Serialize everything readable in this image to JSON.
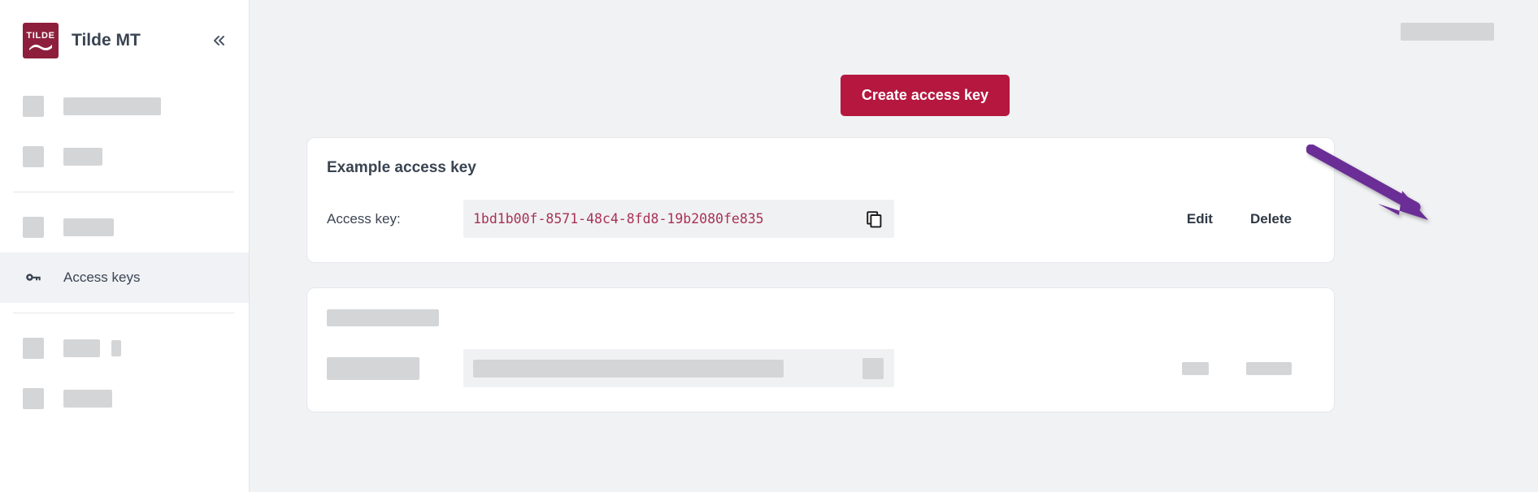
{
  "brand": {
    "logo_text": "TILDE",
    "logo_icon": "tilde-wave-logo",
    "title": "Tilde MT",
    "collapse_icon": "double-chevron-left-icon",
    "logo_color": "#8d1f3d"
  },
  "sidebar": {
    "items": [
      {
        "label": "",
        "redacted": true,
        "icon": "redacted-icon",
        "label_width": 120
      },
      {
        "label": "",
        "redacted": true,
        "icon": "redacted-icon",
        "label_width": 48
      },
      {
        "label": "",
        "redacted": true,
        "icon": "redacted-icon",
        "label_width": 62
      },
      {
        "label": "Access keys",
        "redacted": false,
        "icon": "key-icon",
        "active": true
      },
      {
        "label": "",
        "redacted": true,
        "icon": "redacted-icon",
        "label_width": 45,
        "extra_block": true
      },
      {
        "label": "",
        "redacted": true,
        "icon": "redacted-icon",
        "label_width": 60
      }
    ]
  },
  "topbar": {
    "account_redacted": true
  },
  "toolbar": {
    "create_label": "Create access key",
    "create_color": "#b5173f"
  },
  "cards": [
    {
      "title": "Example access key",
      "redacted": false,
      "key_label": "Access key:",
      "key_value": "1bd1b00f-8571-48c4-8fd8-19b2080fe835",
      "copy_icon": "copy-icon",
      "edit_label": "Edit",
      "delete_label": "Delete"
    },
    {
      "title": "",
      "redacted": true,
      "key_label": "",
      "key_value": "",
      "copy_icon": "copy-icon",
      "edit_label": "",
      "delete_label": ""
    }
  ],
  "annotation": {
    "type": "arrow",
    "color": "#6a2e96",
    "points_to": "Edit",
    "direction": "down-right"
  }
}
